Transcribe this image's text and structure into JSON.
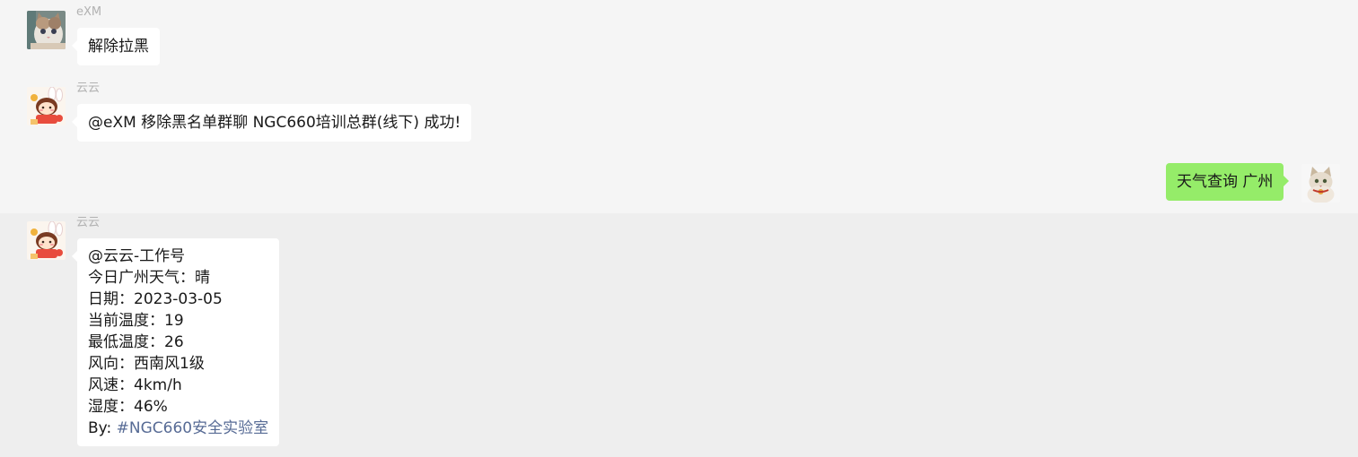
{
  "messages": [
    {
      "sender": "eXM",
      "avatar_icon": "cat-avatar-icon",
      "text": "解除拉黑"
    },
    {
      "sender": "云云",
      "avatar_icon": "cartoon-girl-avatar-icon",
      "text": "@eXM 移除黑名单群聊 NGC660培训总群(线下) 成功!"
    },
    {
      "self": true,
      "avatar_icon": "cat-avatar-icon",
      "text": "天气查询 广州"
    },
    {
      "sender": "云云",
      "avatar_icon": "cartoon-girl-avatar-icon",
      "lines": [
        "@云云-工作号",
        "今日广州天气：晴",
        "日期：2023-03-05",
        "当前温度：19",
        "最低温度：26",
        "风向：西南风1级",
        "风速：4km/h",
        "湿度：46%"
      ],
      "footer_prefix": "By: ",
      "footer_link": "#NGC660安全实验室"
    }
  ],
  "colors": {
    "background": "#f5f5f5",
    "hover_band": "#eeeeee",
    "bubble_other": "#ffffff",
    "bubble_self": "#95ec69",
    "sender_name": "#b2b2b2",
    "link": "#576b95"
  }
}
